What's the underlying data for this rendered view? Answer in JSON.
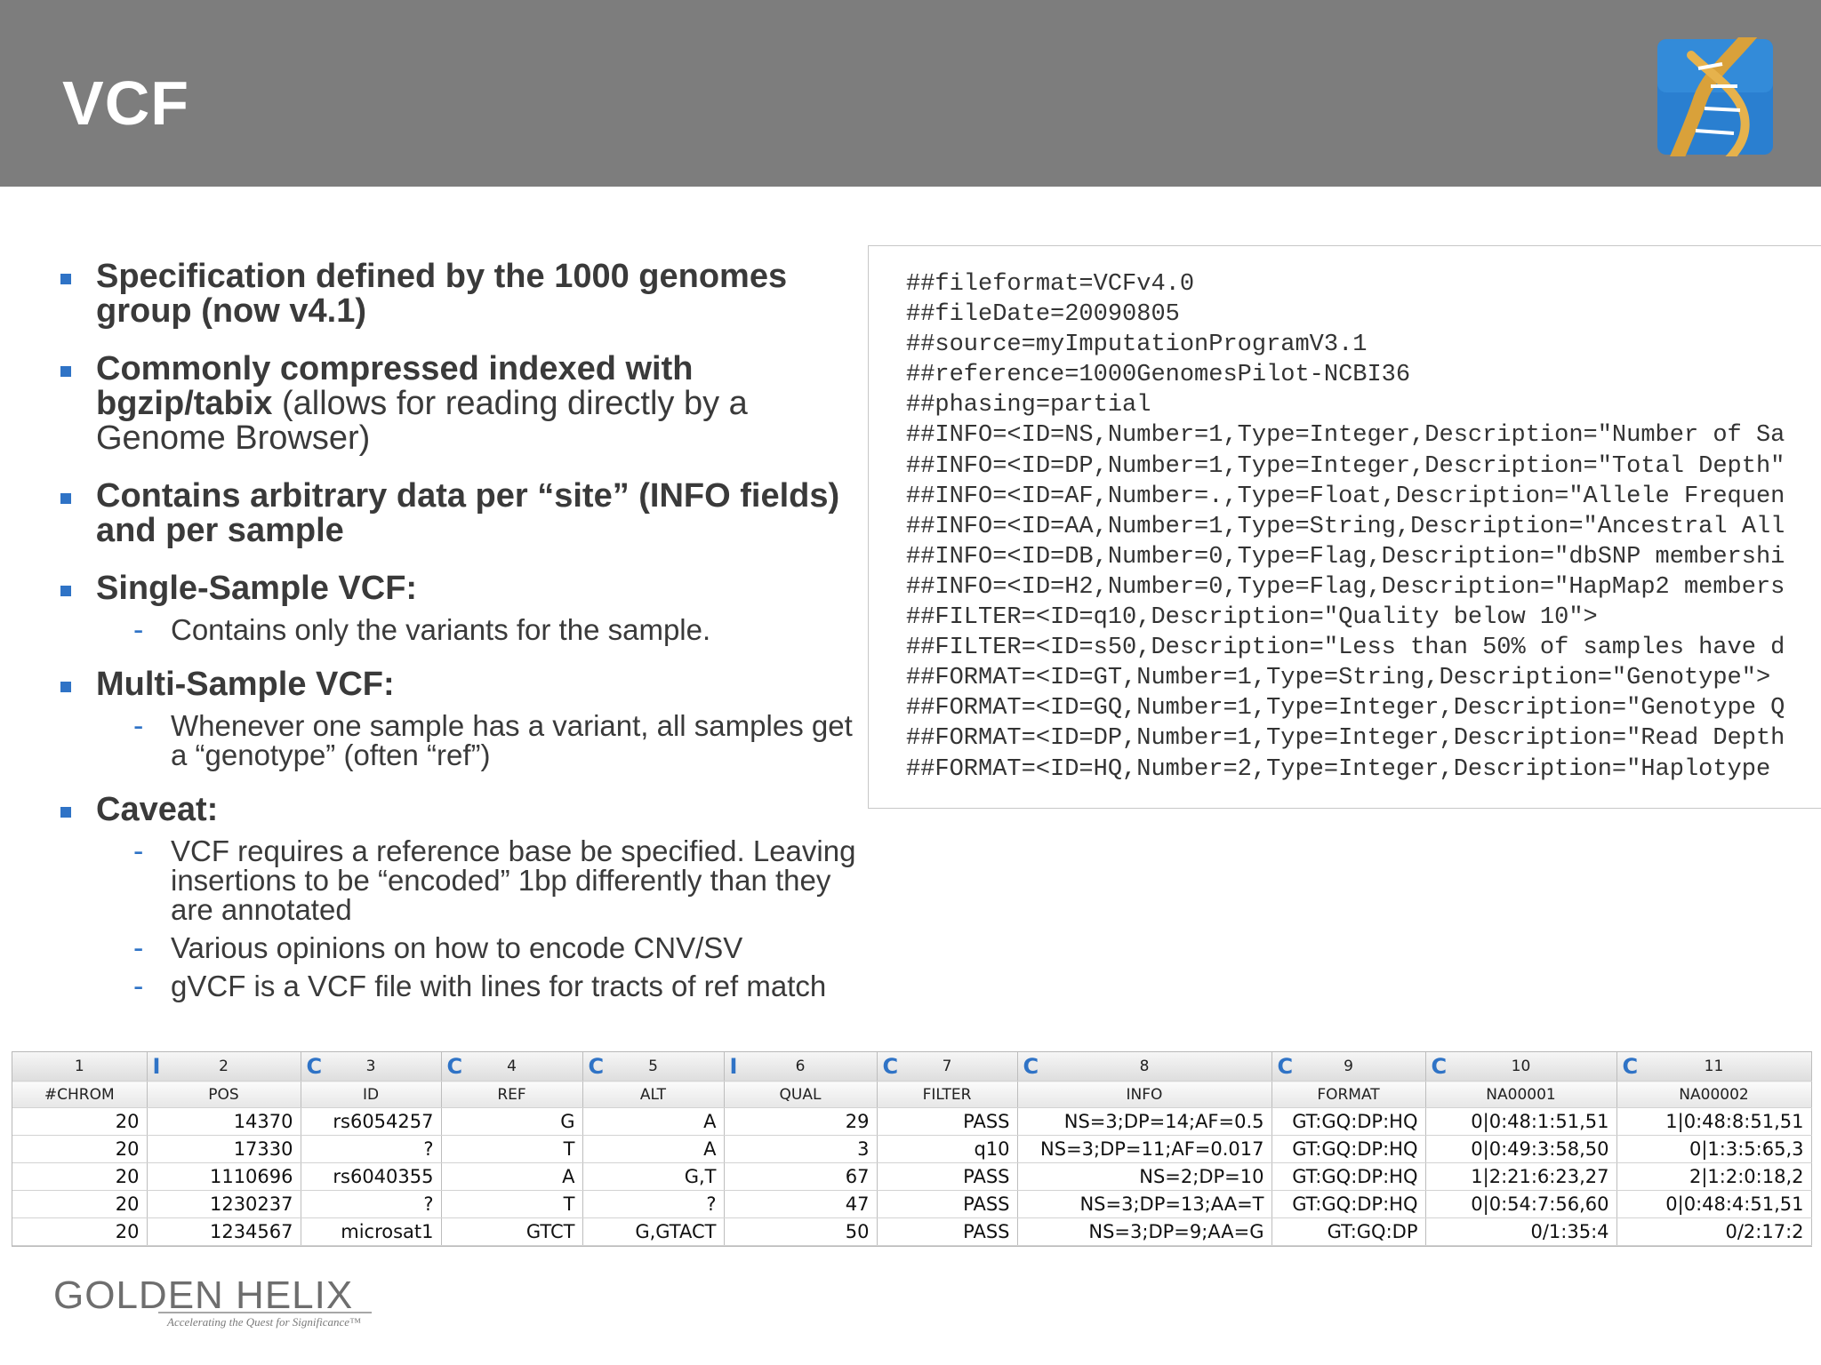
{
  "slide": {
    "title": "VCF"
  },
  "bullets": [
    {
      "bold": "Specification defined by the 1000 genomes group (now v4.1)",
      "rest": "",
      "subs": []
    },
    {
      "bold": "Commonly compressed indexed with bgzip/tabix",
      "rest": " (allows for reading directly by a Genome Browser)",
      "subs": []
    },
    {
      "bold": "Contains arbitrary data per “site” (INFO fields) and per sample",
      "rest": "",
      "subs": []
    },
    {
      "bold": "Single-Sample VCF:",
      "rest": "",
      "subs": [
        "Contains only the variants for the sample."
      ]
    },
    {
      "bold": "Multi-Sample VCF:",
      "rest": "",
      "subs": [
        "Whenever one sample has a variant, all samples get a “genotype” (often “ref”)"
      ]
    },
    {
      "bold": "Caveat:",
      "rest": "",
      "subs": [
        "VCF requires a reference base be specified. Leaving insertions to be “encoded” 1bp differently than they are annotated",
        "Various opinions on how to encode CNV/SV",
        "gVCF is a VCF file with lines for tracts of ref match"
      ]
    }
  ],
  "code_lines": [
    "##fileformat=VCFv4.0",
    "##fileDate=20090805",
    "##source=myImputationProgramV3.1",
    "##reference=1000GenomesPilot-NCBI36",
    "##phasing=partial",
    "##INFO=<ID=NS,Number=1,Type=Integer,Description=\"Number of Sa",
    "##INFO=<ID=DP,Number=1,Type=Integer,Description=\"Total Depth\"",
    "##INFO=<ID=AF,Number=.,Type=Float,Description=\"Allele Frequen",
    "##INFO=<ID=AA,Number=1,Type=String,Description=\"Ancestral All",
    "##INFO=<ID=DB,Number=0,Type=Flag,Description=\"dbSNP membershi",
    "##INFO=<ID=H2,Number=0,Type=Flag,Description=\"HapMap2 members",
    "##FILTER=<ID=q10,Description=\"Quality below 10\">",
    "##FILTER=<ID=s50,Description=\"Less than 50% of samples have d",
    "##FORMAT=<ID=GT,Number=1,Type=String,Description=\"Genotype\">",
    "##FORMAT=<ID=GQ,Number=1,Type=Integer,Description=\"Genotype Q",
    "##FORMAT=<ID=DP,Number=1,Type=Integer,Description=\"Read Depth",
    "##FORMAT=<ID=HQ,Number=2,Type=Integer,Description=\"Haplotype"
  ],
  "table": {
    "col_numbers": [
      "1",
      "2",
      "3",
      "4",
      "5",
      "6",
      "7",
      "8",
      "9",
      "10",
      "11"
    ],
    "col_types": [
      "",
      "I",
      "C",
      "C",
      "C",
      "I",
      "C",
      "C",
      "C",
      "C",
      "C"
    ],
    "headers": [
      "#CHROM",
      "POS",
      "ID",
      "REF",
      "ALT",
      "QUAL",
      "FILTER",
      "INFO",
      "FORMAT",
      "NA00001",
      "NA00002"
    ],
    "rows": [
      [
        "20",
        "14370",
        "rs6054257",
        "G",
        "A",
        "29",
        "PASS",
        "NS=3;DP=14;AF=0.5",
        "GT:GQ:DP:HQ",
        "0|0:48:1:51,51",
        "1|0:48:8:51,51"
      ],
      [
        "20",
        "17330",
        "?",
        "T",
        "A",
        "3",
        "q10",
        "NS=3;DP=11;AF=0.017",
        "GT:GQ:DP:HQ",
        "0|0:49:3:58,50",
        "0|1:3:5:65,3"
      ],
      [
        "20",
        "1110696",
        "rs6040355",
        "A",
        "G,T",
        "67",
        "PASS",
        "NS=2;DP=10",
        "GT:GQ:DP:HQ",
        "1|2:21:6:23,27",
        "2|1:2:0:18,2"
      ],
      [
        "20",
        "1230237",
        "?",
        "T",
        "?",
        "47",
        "PASS",
        "NS=3;DP=13;AA=T",
        "GT:GQ:DP:HQ",
        "0|0:54:7:56,60",
        "0|0:48:4:51,51"
      ],
      [
        "20",
        "1234567",
        "microsat1",
        "GTCT",
        "G,GTACT",
        "50",
        "PASS",
        "NS=3;DP=9;AA=G",
        "GT:GQ:DP",
        "0/1:35:4",
        "0/2:17:2"
      ]
    ]
  },
  "footer": {
    "brand": "GOLDEN HELIX",
    "tagline": "Accelerating the Quest for Significance™"
  },
  "colors": {
    "header_bg": "#7d7d7d",
    "accent_blue": "#2f73c6",
    "logo_gold": "#d9a13a"
  }
}
